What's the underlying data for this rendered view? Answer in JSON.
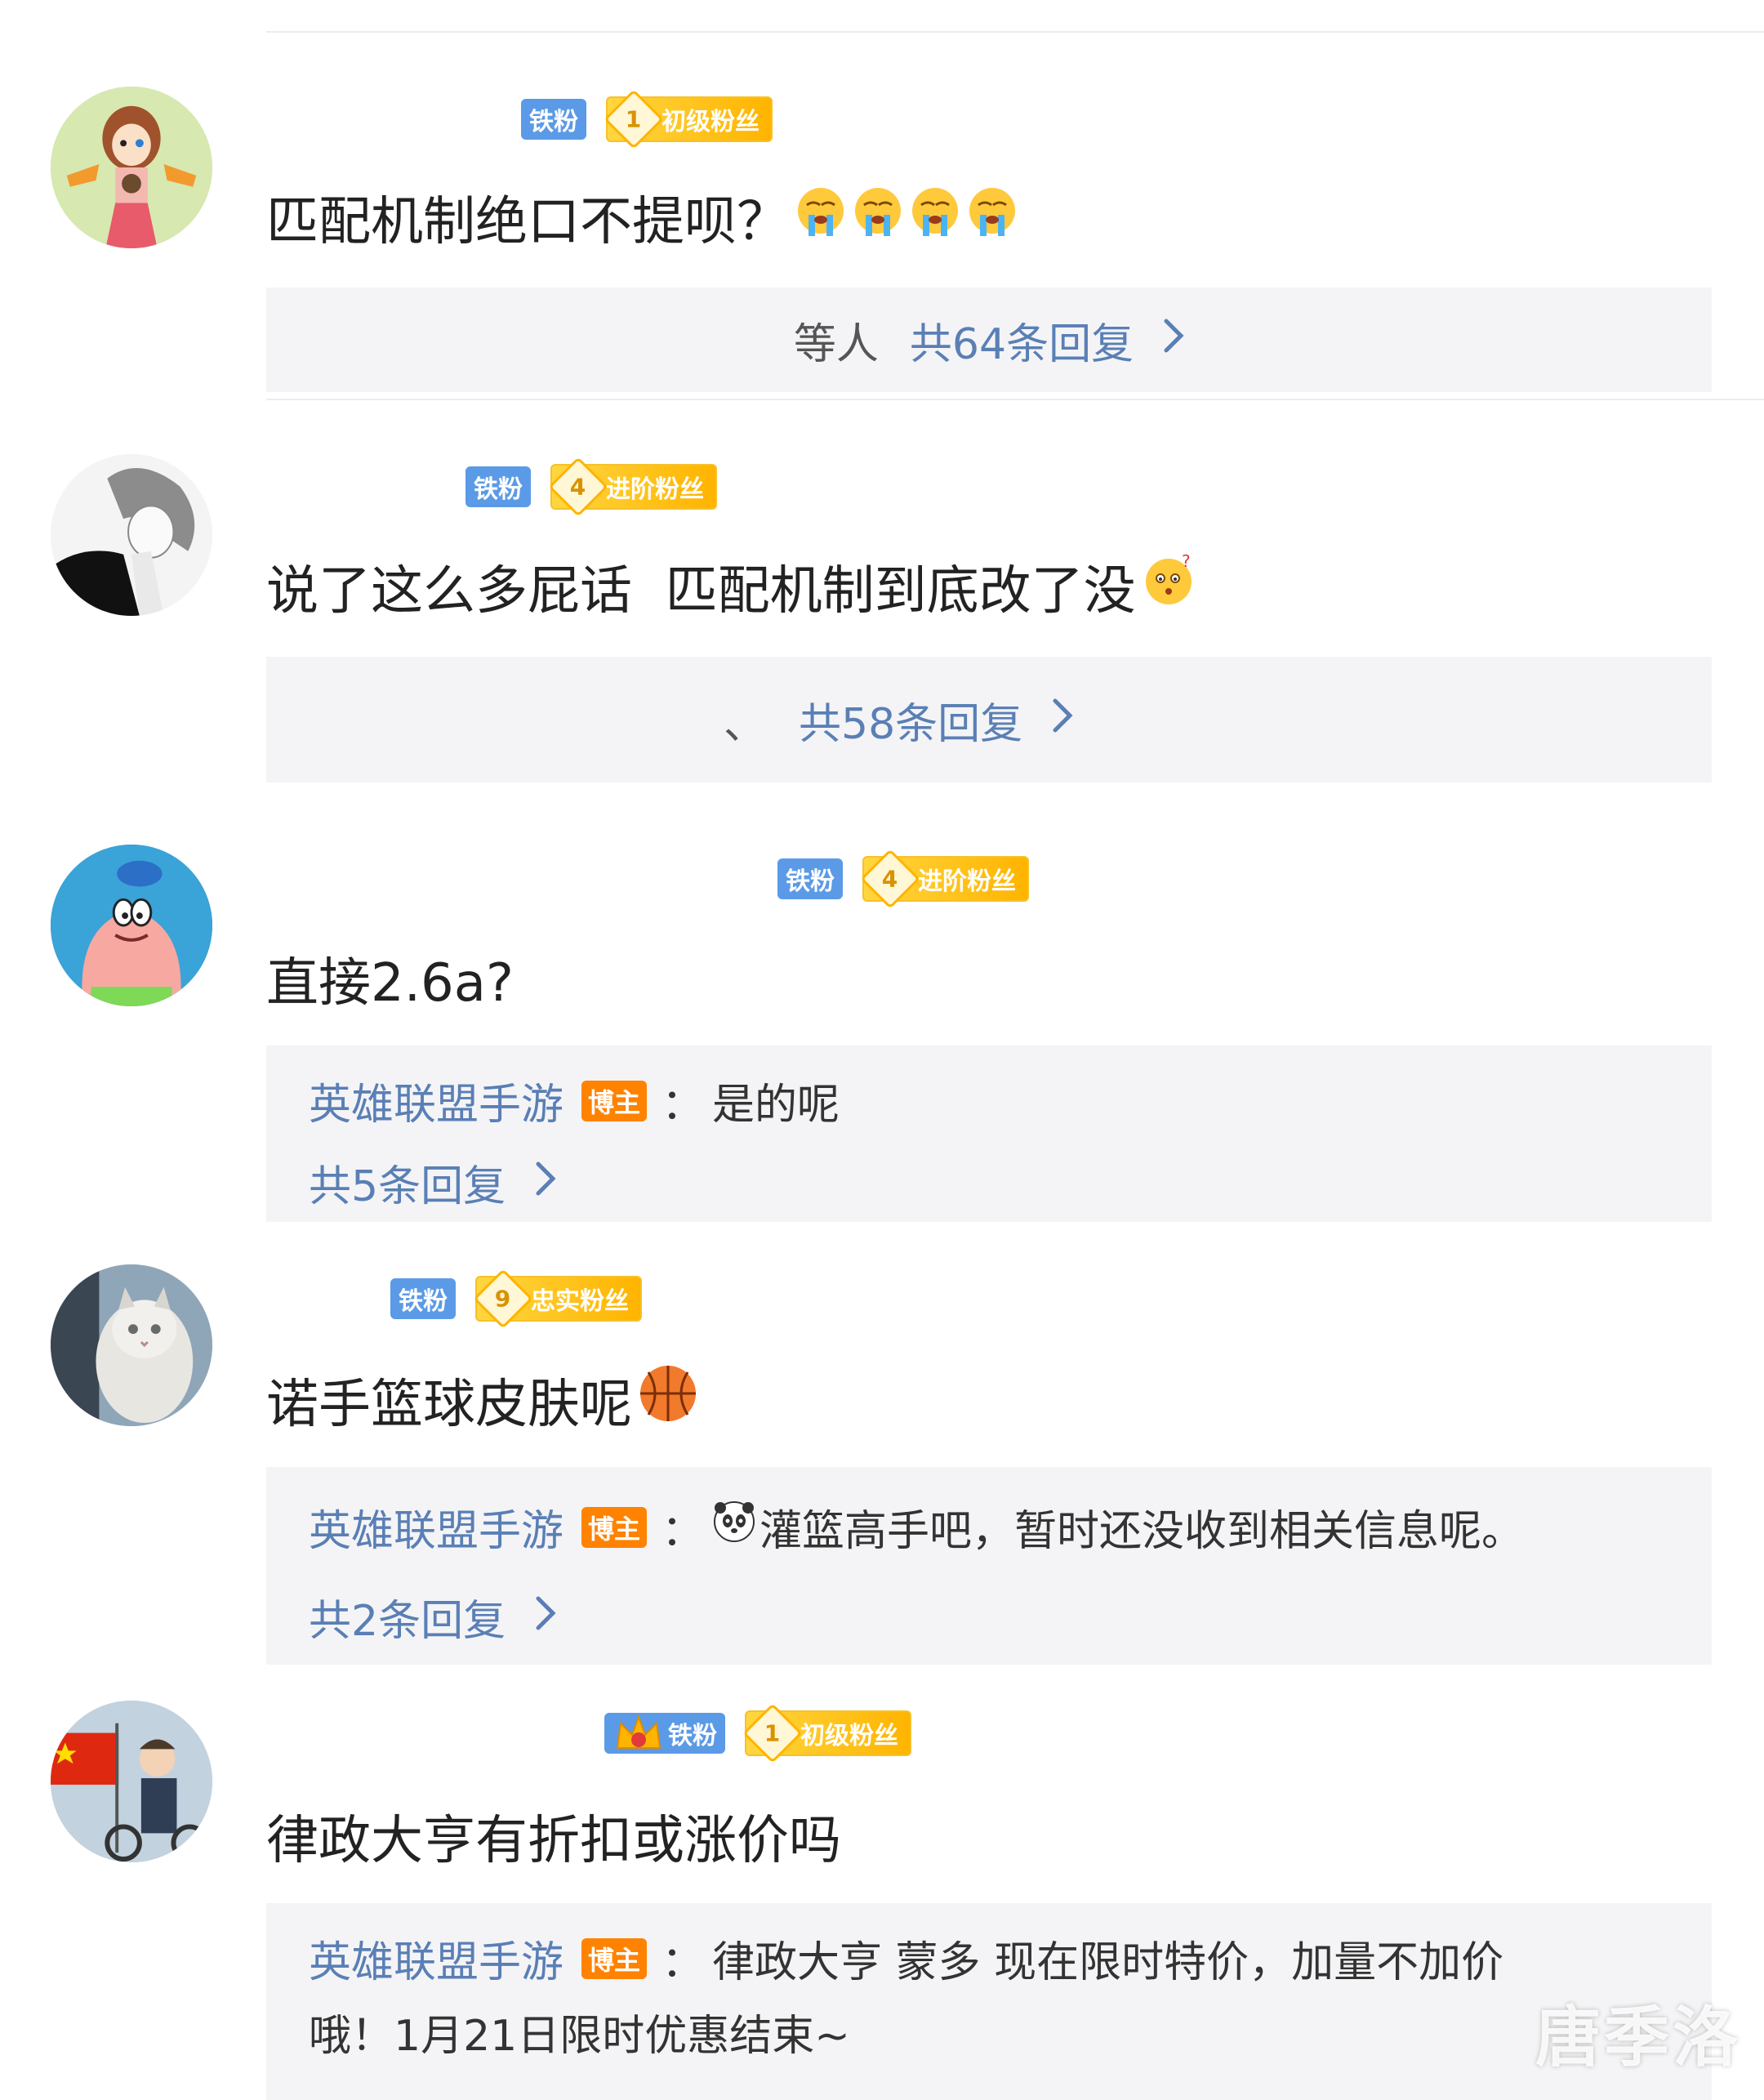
{
  "badges": {
    "iron_fan": "铁粉",
    "host": "博主"
  },
  "comments": [
    {
      "avatar": "avatar-girl-with-wings",
      "fan_level": "1",
      "fan_title": "初级粉丝",
      "text": "匹配机制绝口不提呗？",
      "emoji": "crying-emoji",
      "reply_prefix": "等人",
      "reply_count_text": "共64条回复"
    },
    {
      "avatar": "avatar-anime-boy",
      "fan_level": "4",
      "fan_title": "进阶粉丝",
      "text": "说了这么多屁话  匹配机制到底改了没",
      "emoji": "confused-emoji",
      "reply_prefix": "、",
      "reply_count_text": "共58条回复"
    },
    {
      "avatar": "avatar-patrick-star",
      "fan_level": "4",
      "fan_title": "进阶粉丝",
      "text": "直接2.6a?",
      "reply_author": "英雄联盟手游",
      "reply_sep": "：",
      "reply_text": "是的呢",
      "reply_count_text": "共5条回复"
    },
    {
      "avatar": "avatar-white-cat",
      "fan_level": "9",
      "fan_title": "忠实粉丝",
      "text": "诺手篮球皮肤呢",
      "emoji": "basketball-emoji",
      "reply_author": "英雄联盟手游",
      "reply_sep": "：",
      "reply_emoji": "panda-emoji",
      "reply_text": "灌篮高手吧，暂时还没收到相关信息呢。",
      "reply_count_text": "共2条回复"
    },
    {
      "avatar": "avatar-girl-with-flag",
      "fan_level": "1",
      "fan_title": "初级粉丝",
      "text": "律政大亨有折扣或涨价吗",
      "reply_author": "英雄联盟手游",
      "reply_sep": "：",
      "reply_text_line1": "律政大亨 蒙多 现在限时特价，加量不加价",
      "reply_text_line2": "哦！1月21日限时优惠结束~"
    }
  ],
  "watermark": "唐季洛",
  "colors": {
    "link": "#5a7fb5",
    "iron_badge": "#5b9ae6",
    "fan_badge": "#ffb400",
    "host_badge": "#ff8200",
    "reply_bg": "#f4f4f6"
  }
}
